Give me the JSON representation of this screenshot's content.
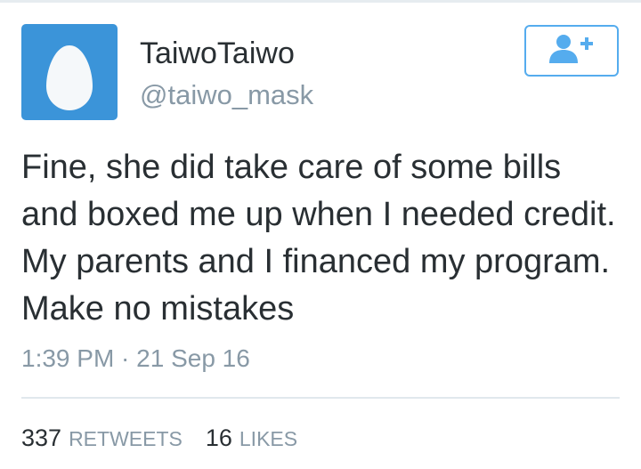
{
  "tweet": {
    "author": {
      "display_name": "TaiwoTaiwo",
      "handle": "@taiwo_mask",
      "avatar_icon": "default-egg-icon",
      "avatar_color": "#3b94d9"
    },
    "follow_button": {
      "icon": "follow-user-plus-icon",
      "color": "#55acee"
    },
    "text": "Fine, she did take care of some bills and boxed me up when I needed credit. My parents and I financed my program. Make no mistakes",
    "timestamp": "1:39 PM · 21 Sep 16",
    "stats": {
      "retweets_count": "337",
      "retweets_label": "RETWEETS",
      "likes_count": "16",
      "likes_label": "LIKES"
    }
  }
}
